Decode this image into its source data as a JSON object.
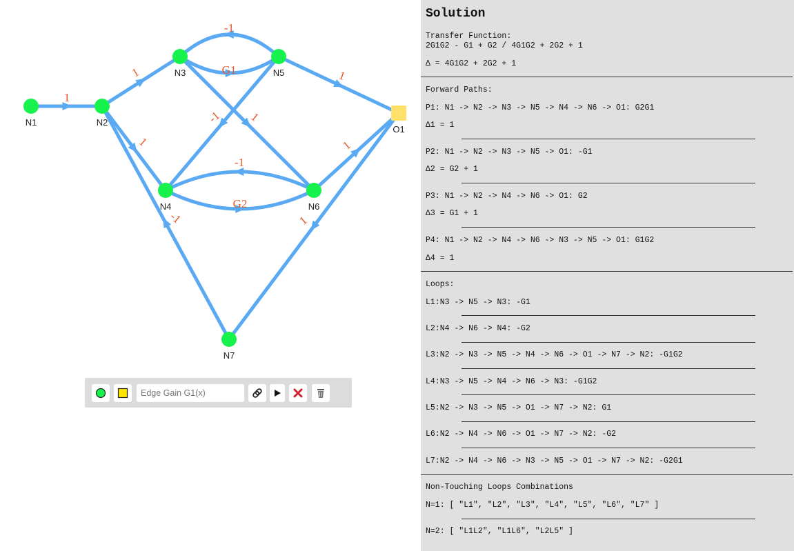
{
  "graph": {
    "nodes": [
      {
        "id": "N1",
        "label": "N1",
        "type": "input"
      },
      {
        "id": "N2",
        "label": "N2",
        "type": "node"
      },
      {
        "id": "N3",
        "label": "N3",
        "type": "node"
      },
      {
        "id": "N4",
        "label": "N4",
        "type": "node"
      },
      {
        "id": "N5",
        "label": "N5",
        "type": "node"
      },
      {
        "id": "N6",
        "label": "N6",
        "type": "node"
      },
      {
        "id": "N7",
        "label": "N7",
        "type": "node"
      },
      {
        "id": "O1",
        "label": "O1",
        "type": "output"
      }
    ],
    "edges": [
      {
        "from": "N1",
        "to": "N2",
        "gain": "1"
      },
      {
        "from": "N2",
        "to": "N3",
        "gain": "1"
      },
      {
        "from": "N2",
        "to": "N4",
        "gain": "1"
      },
      {
        "from": "N3",
        "to": "N5",
        "gain": "G1"
      },
      {
        "from": "N5",
        "to": "N3",
        "gain": "-1"
      },
      {
        "from": "N3",
        "to": "N6",
        "gain": "1"
      },
      {
        "from": "N5",
        "to": "N4",
        "gain": "-1"
      },
      {
        "from": "N4",
        "to": "N6",
        "gain": "G2"
      },
      {
        "from": "N6",
        "to": "N4",
        "gain": "-1"
      },
      {
        "from": "N5",
        "to": "O1",
        "gain": "1"
      },
      {
        "from": "N6",
        "to": "O1",
        "gain": "1"
      },
      {
        "from": "O1",
        "to": "N7",
        "gain": "1"
      },
      {
        "from": "N7",
        "to": "N2",
        "gain": "-1"
      }
    ]
  },
  "toolbar": {
    "add_node_icon": "green-circle-icon",
    "add_output_icon": "yellow-square-icon",
    "gain_placeholder": "Edge Gain G1(x)",
    "link_icon": "paperclip-icon",
    "play_icon": "play-icon",
    "delete_icon": "red-x-icon",
    "clear_icon": "trash-icon",
    "colors": {
      "node": "#18f24c",
      "output": "#ffe06a",
      "edge": "#5aa9f3",
      "gain": "#e5582a",
      "delete": "#d2202f"
    }
  },
  "solution": {
    "title": "Solution",
    "tf_label": "Transfer Function:",
    "tf_value": "2G1G2 - G1 + G2 / 4G1G2 + 2G2 + 1",
    "delta": "∆ = 4G1G2 + 2G2 + 1",
    "fp_label": "Forward Paths:",
    "paths": [
      {
        "text": "P1: N1 -> N2 -> N3 -> N5 -> N4 -> N6 -> O1: G2G1",
        "delta": "∆1 = 1"
      },
      {
        "text": "P2: N1 -> N2 -> N3 -> N5 -> O1: -G1",
        "delta": "∆2 = G2 + 1"
      },
      {
        "text": "P3: N1 -> N2 -> N4 -> N6 -> O1: G2",
        "delta": "∆3 = G1 + 1"
      },
      {
        "text": "P4: N1 -> N2 -> N4 -> N6 -> N3 -> N5 -> O1: G1G2",
        "delta": "∆4 = 1"
      }
    ],
    "loops_label": "Loops:",
    "loops": [
      "L1:N3 -> N5 -> N3: -G1",
      "L2:N4 -> N6 -> N4: -G2",
      "L3:N2 -> N3 -> N5 -> N4 -> N6 -> O1 -> N7 -> N2: -G1G2",
      "L4:N3 -> N5 -> N4 -> N6 -> N3: -G1G2",
      "L5:N2 -> N3 -> N5 -> O1 -> N7 -> N2: G1",
      "L6:N2 -> N4 -> N6 -> O1 -> N7 -> N2: -G2",
      "L7:N2 -> N4 -> N6 -> N3 -> N5 -> O1 -> N7 -> N2: -G2G1"
    ],
    "ntl_label": "Non-Touching Loops Combinations",
    "ntl": [
      "N=1: [ \"L1\", \"L2\", \"L3\", \"L4\", \"L5\", \"L6\", \"L7\" ]",
      "N=2: [ \"L1L2\", \"L1L6\", \"L2L5\" ]"
    ]
  }
}
